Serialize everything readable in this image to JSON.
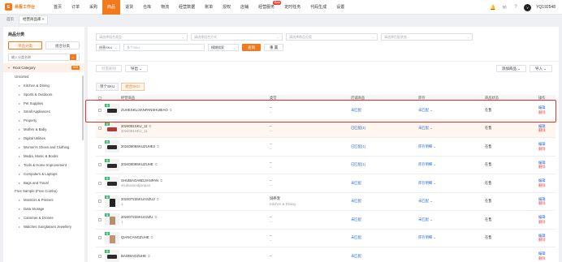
{
  "app": {
    "logo_mark": "E",
    "logo_text": "易看工作台"
  },
  "topnav": [
    {
      "label": "首页"
    },
    {
      "label": "订单"
    },
    {
      "label": "采购"
    },
    {
      "label": "商品",
      "active": true
    },
    {
      "label": "退货"
    },
    {
      "label": "仓库"
    },
    {
      "label": "物流"
    },
    {
      "label": "经营数据"
    },
    {
      "label": "账单"
    },
    {
      "label": "授权"
    },
    {
      "label": "店铺"
    },
    {
      "label": "经营服务",
      "badge": "New"
    },
    {
      "label": "定时任务"
    },
    {
      "label": "代码生成"
    },
    {
      "label": "设置"
    }
  ],
  "user": {
    "name": "YQ192548",
    "avatar": "Y"
  },
  "breadcrumb": [
    {
      "label": "首页"
    },
    {
      "label": "经营商品库 ×",
      "active": true
    }
  ],
  "left": {
    "title": "商品分类",
    "tabs": [
      {
        "label": "单品分类",
        "active": true
      },
      {
        "label": "组合分类"
      }
    ],
    "search_placeholder": "输入分类名称",
    "tree": [
      {
        "label": "Root Category",
        "count": "520",
        "root": true
      },
      {
        "label": "Unsorted",
        "level": "l1"
      },
      {
        "label": "Kitchen & Dining",
        "level": "l1b",
        "caret": true
      },
      {
        "label": "Sports & Outdoors",
        "level": "l1b",
        "caret": true
      },
      {
        "label": "Pet Supplies",
        "level": "l1b",
        "caret": true
      },
      {
        "label": "Small Appliances",
        "level": "l1b",
        "caret": true
      },
      {
        "label": "Property",
        "level": "l1b",
        "caret": true
      },
      {
        "label": "Mother & Baby",
        "level": "l1b",
        "caret": true
      },
      {
        "label": "Digital Utilities",
        "level": "l1b",
        "caret": true
      },
      {
        "label": "Women's Shoes and Clothing",
        "level": "l1b",
        "caret": true
      },
      {
        "label": "Media, Music & Books",
        "level": "l1b",
        "caret": true
      },
      {
        "label": "Tools & Home Improvement",
        "level": "l1b",
        "caret": true
      },
      {
        "label": "Computers & Laptops",
        "level": "l1b",
        "caret": true
      },
      {
        "label": "Bags and Travel",
        "level": "l1b",
        "caret": true
      },
      {
        "label": "Free Sample (Free Combo)",
        "level": "l1"
      },
      {
        "label": "Monitors & Printers",
        "level": "l1b",
        "caret": true
      },
      {
        "label": "Data Storage",
        "level": "l1b",
        "caret": true
      },
      {
        "label": "Cameras & Drones",
        "level": "l1b",
        "caret": true
      },
      {
        "label": "Watches Sunglasses Jewellery",
        "level": "l1b",
        "caret": true
      }
    ]
  },
  "filters": {
    "row1": [
      "请选择组合类型",
      "请选择组合方式",
      "请选择商品分类",
      "请选择匹配状态"
    ],
    "sku_select": "经营SKU",
    "sku_input_placeholder": "多个SKU",
    "match_mode": "模糊搜索",
    "search_btn": "查询",
    "reset_btn": "重 置"
  },
  "actions": {
    "batch_delete": "批量删除",
    "export": "导出",
    "add_product": "添加商品",
    "import": "导入"
  },
  "subtabs": [
    {
      "label": "单个SKU"
    },
    {
      "label": "组合SKU",
      "active": true
    }
  ],
  "table": {
    "headers": [
      "经营商品",
      "类型",
      "店铺商品",
      "库存",
      "商品状态",
      "操作"
    ],
    "rows": [
      {
        "name": "ZUHESKUJIANPANSHUBIAO",
        "sub": "",
        "type": "--",
        "type_sub": "--",
        "shop": "未匹配",
        "stock": "未匹配",
        "status": "在售",
        "thumb": "keyboard",
        "color": "#2a2a2a"
      },
      {
        "name": "2024081SKU_11",
        "sub": "2024081SKU_11",
        "type": "--",
        "type_sub": "--",
        "shop": "已匹配(1)",
        "stock": "未匹配",
        "status": "在售",
        "thumb": "keyboard",
        "color": "#b03a3a"
      },
      {
        "name": "20240809SKUZUHE2",
        "sub": "",
        "type": "--",
        "type_sub": "--",
        "shop": "已匹配(1)",
        "stock": "库存明细",
        "status": "在售",
        "thumb": "keyboard",
        "color": "#2a2a2a"
      },
      {
        "name": "20240809SKUZUHE",
        "sub": "",
        "type": "--",
        "type_sub": "--",
        "shop": "已匹配(1)",
        "stock": "库存明细",
        "status": "在售",
        "thumb": "keyboard",
        "color": "#2a2a2a"
      },
      {
        "name": "SHUBIAOANDJIANPAN",
        "sub": "shubiaoandjianpan",
        "type": "--",
        "type_sub": "--",
        "shop": "未匹配",
        "stock": "库存明细",
        "status": "在售",
        "thumb": "keyboard",
        "color": "#2a2a2a"
      },
      {
        "name": "20240723SKUASZU2",
        "sub": "1",
        "type": "饲养宠",
        "type_sub": "Kitchen & Dining",
        "shop": "未匹配",
        "stock": "未匹配",
        "status": "在售",
        "thumb": "shirt",
        "color": "#222222"
      },
      {
        "name": "20240723SKUASZU",
        "sub": "1",
        "type": "--",
        "type_sub": "--",
        "shop": "未匹配",
        "stock": "未匹配",
        "status": "在售",
        "thumb": "shirt",
        "color": "#b98e6b"
      },
      {
        "name": "QIANCANGZUHE",
        "sub": "",
        "type": "--",
        "type_sub": "--",
        "shop": "未匹配",
        "stock": "库存明细",
        "status": "在售",
        "thumb": "shirt",
        "color": "#c29473"
      },
      {
        "name": "BAOBIAOZUHE",
        "sub": "",
        "type": "--",
        "type_sub": "",
        "shop": "未匹配",
        "stock": "",
        "status": "",
        "thumb": "keyboard",
        "color": "#2a2a2a"
      }
    ],
    "op_edit": "编辑",
    "op_delete": "删除",
    "thumb_tag": "组"
  }
}
